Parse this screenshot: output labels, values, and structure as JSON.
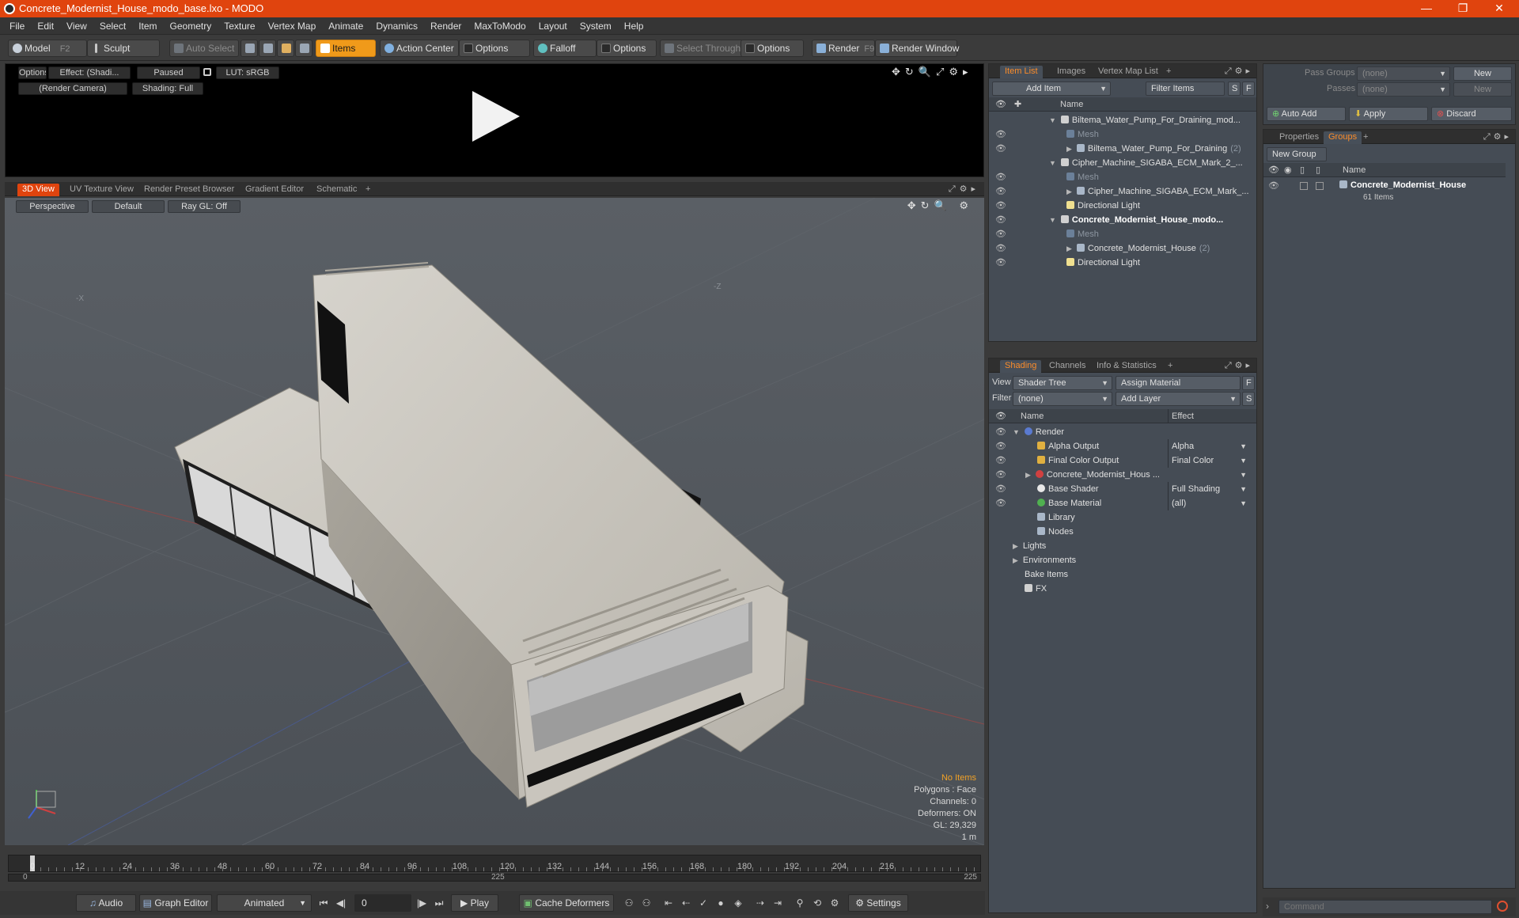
{
  "window": {
    "title": "Concrete_Modernist_House_modo_base.lxo - MODO",
    "controls": [
      "—",
      "❐",
      "✕"
    ]
  },
  "menu": [
    "File",
    "Edit",
    "View",
    "Select",
    "Item",
    "Geometry",
    "Texture",
    "Vertex Map",
    "Animate",
    "Dynamics",
    "Render",
    "MaxToModo",
    "Layout",
    "System",
    "Help"
  ],
  "toolbar": {
    "model": "Model",
    "model_key": "F2",
    "sculpt": "Sculpt",
    "auto_select": "Auto Select",
    "items": "Items",
    "action_center": "Action Center",
    "options1": "Options",
    "falloff": "Falloff",
    "options2": "Options",
    "select_through": "Select Through",
    "options3": "Options",
    "render": "Render",
    "render_key": "F9",
    "render_window": "Render Window"
  },
  "preview": {
    "options": "Options",
    "effect": "Effect: (Shadi...",
    "paused": "Paused",
    "lut": "LUT: sRGB",
    "camera": "(Render Camera)",
    "shading": "Shading: Full"
  },
  "viewport_tabs": [
    "3D View",
    "UV Texture View",
    "Render Preset Browser",
    "Gradient Editor",
    "Schematic",
    "+"
  ],
  "viewport": {
    "perspective": "Perspective",
    "default": "Default",
    "raygl": "Ray GL: Off",
    "hud": {
      "no_items": "No Items",
      "polygons": "Polygons : Face",
      "channels": "Channels: 0",
      "deformers": "Deformers: ON",
      "gl": "GL: 29,329",
      "scale": "1 m"
    }
  },
  "timeline": {
    "ticks": [
      "0",
      "12",
      "24",
      "36",
      "48",
      "60",
      "72",
      "84",
      "96",
      "108",
      "120",
      "132",
      "144",
      "156",
      "168",
      "180",
      "192",
      "204",
      "216"
    ],
    "range_start": "0",
    "range_mid": "225",
    "range_end": "225"
  },
  "transport": {
    "audio": "Audio",
    "graph_editor": "Graph Editor",
    "animated": "Animated",
    "frame": "0",
    "play": "Play",
    "cache_deformers": "Cache Deformers",
    "settings": "Settings"
  },
  "item_list": {
    "tabs": [
      "Item List",
      "Images",
      "Vertex Map List",
      "+"
    ],
    "add_item": "Add Item",
    "filter_items": "Filter Items",
    "s_btn": "S",
    "f_btn": "F",
    "col_name": "Name",
    "rows": [
      {
        "label": "Biltema_Water_Pump_For_Draining_mod...",
        "indent": 0,
        "kind": "scene"
      },
      {
        "label": "Mesh",
        "indent": 1,
        "kind": "mesh"
      },
      {
        "label": "Biltema_Water_Pump_For_Draining",
        "count": "(2)",
        "indent": 1,
        "kind": "group"
      },
      {
        "label": "Cipher_Machine_SIGABA_ECM_Mark_2_...",
        "indent": 0,
        "kind": "scene"
      },
      {
        "label": "Mesh",
        "indent": 1,
        "kind": "mesh"
      },
      {
        "label": "Cipher_Machine_SIGABA_ECM_Mark_...",
        "indent": 1,
        "kind": "group"
      },
      {
        "label": "Directional Light",
        "indent": 1,
        "kind": "light"
      },
      {
        "label": "Concrete_Modernist_House_modo...",
        "indent": 0,
        "kind": "scene-active"
      },
      {
        "label": "Mesh",
        "indent": 1,
        "kind": "mesh"
      },
      {
        "label": "Concrete_Modernist_House",
        "count": "(2)",
        "indent": 1,
        "kind": "group"
      },
      {
        "label": "Directional Light",
        "indent": 1,
        "kind": "light"
      }
    ]
  },
  "pass_panel": {
    "pass_groups_label": "Pass Groups",
    "pass_groups_value": "(none)",
    "passes_label": "Passes",
    "passes_value": "(none)",
    "new": "New",
    "new2": "New",
    "auto_add": "Auto Add",
    "apply": "Apply",
    "discard": "Discard"
  },
  "groups_panel": {
    "tabs": [
      "Properties",
      "Groups",
      "+"
    ],
    "new_group": "New Group",
    "col_name": "Name",
    "group_name": "Concrete_Modernist_House",
    "group_count": "61 Items"
  },
  "shading": {
    "tabs": [
      "Shading",
      "Channels",
      "Info & Statistics",
      "+"
    ],
    "view_label": "View",
    "view_value": "Shader Tree",
    "assign_material": "Assign Material",
    "f_btn": "F",
    "filter_label": "Filter",
    "filter_value": "(none)",
    "add_layer": "Add Layer",
    "s_btn": "S",
    "col_name": "Name",
    "col_effect": "Effect",
    "rows": [
      {
        "label": "Render",
        "effect": "",
        "indent": 0,
        "icon": "render"
      },
      {
        "label": "Alpha Output",
        "effect": "Alpha",
        "indent": 1,
        "icon": "output"
      },
      {
        "label": "Final Color Output",
        "effect": "Final Color",
        "indent": 1,
        "icon": "output"
      },
      {
        "label": "Concrete_Modernist_Hous ...",
        "effect": "",
        "indent": 1,
        "icon": "material-red"
      },
      {
        "label": "Base Shader",
        "effect": "Full Shading",
        "indent": 1,
        "icon": "shader"
      },
      {
        "label": "Base Material",
        "effect": "(all)",
        "indent": 1,
        "icon": "material-green"
      },
      {
        "label": "Library",
        "effect": "",
        "indent": 1,
        "icon": "folder"
      },
      {
        "label": "Nodes",
        "effect": "",
        "indent": 1,
        "icon": "folder"
      },
      {
        "label": "Lights",
        "effect": "",
        "indent": 0,
        "icon": "none"
      },
      {
        "label": "Environments",
        "effect": "",
        "indent": 0,
        "icon": "none"
      },
      {
        "label": "Bake Items",
        "effect": "",
        "indent": 0,
        "icon": "none"
      },
      {
        "label": "FX",
        "effect": "",
        "indent": 0,
        "icon": "fx"
      }
    ]
  },
  "command": {
    "placeholder": "Command"
  },
  "colors": {
    "accent": "#e0440e",
    "active_tool": "#f09a1a",
    "panel": "#454c55",
    "viewport": "#52575d"
  }
}
